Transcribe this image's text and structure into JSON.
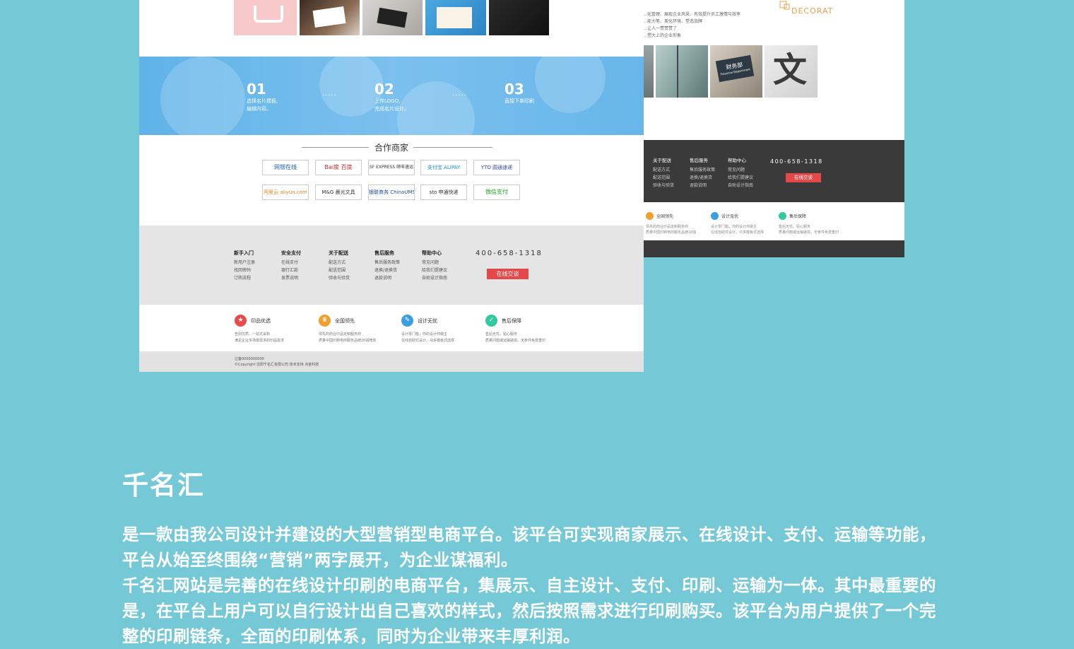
{
  "right_mockup": {
    "top_text": [
      "…化管理、展现企业风采、有效提升员工激情与效率",
      "…能力笔、美化环境、塑造品牌",
      "…让人一赞赞赞了",
      "…塑大上的企业形象"
    ],
    "deco_label": "DECORATION",
    "sign_text": "财务部",
    "sign_sub": "Financial Department",
    "footer_cols": [
      {
        "head": "关于配送",
        "items": [
          "配送方式",
          "配送范围",
          "验收与验货"
        ]
      },
      {
        "head": "售后服务",
        "items": [
          "售后服务政策",
          "退换/退换货",
          "退款说明"
        ]
      },
      {
        "head": "帮助中心",
        "items": [
          "常见问题",
          "给我们提建议",
          "自助设计指南"
        ]
      }
    ],
    "phone": "400-658-1318",
    "chat": "在线交谈",
    "features": [
      {
        "title": "全国领先",
        "desc": [
          "领先的商业印品定制服务商",
          "质量中国印刷电商服务品牌20强"
        ],
        "color": "#f0a030"
      },
      {
        "title": "设计无忧",
        "desc": [
          "设计零门槛，你的设计你做主",
          "在线自助式设计，众多模板式选择"
        ],
        "color": "#3c9ee0"
      },
      {
        "title": "售后保障",
        "desc": [
          "售后无忧，贴心服务",
          "质量问题或运输破损，无条件免费重印"
        ],
        "color": "#33c9a0"
      }
    ]
  },
  "left_mockup": {
    "steps": [
      {
        "num": "01",
        "lines": [
          "选择名片模板,",
          "编辑内容。"
        ]
      },
      {
        "num": "02",
        "lines": [
          "上传LOGO,",
          "完成名片设计。"
        ]
      },
      {
        "num": "03",
        "lines": [
          "直接下单印刷"
        ]
      }
    ],
    "dots": "·····",
    "partners_title": "合作商家",
    "partners": [
      [
        "网银在线",
        "Bai度 百度",
        "SF EXPRESS 顺丰速运",
        "支付宝 ALIPAY",
        "YTO 圆通速递"
      ],
      [
        "阿里云 aliyun.com",
        "M&G 晨光文具",
        "银联商务 ChinaUMS",
        "sto 申通快递",
        "微信支付"
      ]
    ],
    "footer_cols": [
      {
        "head": "新手入门",
        "items": [
          "新用户注册",
          "找回密码",
          "订购流程"
        ]
      },
      {
        "head": "安全支付",
        "items": [
          "在线支付",
          "银行汇款",
          "发票说明"
        ]
      },
      {
        "head": "关于配送",
        "items": [
          "配送方式",
          "配送范围",
          "验收与验货"
        ]
      },
      {
        "head": "售后服务",
        "items": [
          "售后服务政策",
          "退换/退换货",
          "退款说明"
        ]
      },
      {
        "head": "帮助中心",
        "items": [
          "常见问题",
          "给我们提建议",
          "自助设计指南"
        ]
      }
    ],
    "phone": "400-658-1318",
    "chat": "在线交谈",
    "features": [
      {
        "title": "印品优选",
        "desc": [
          "告别优质、一站式采购",
          "满足企业多场景需求的印品需求"
        ],
        "color": "#e84b4b",
        "icon": "★"
      },
      {
        "title": "全国领先",
        "desc": [
          "领先的商业印品定制服务商",
          "质量中国印刷电商服务品牌20强榜单"
        ],
        "color": "#f0a030",
        "icon": "♛"
      },
      {
        "title": "设计无忧",
        "desc": [
          "设计零门槛，你的设计你做主",
          "在线自助式设计，众多模板式选择"
        ],
        "color": "#3c9ee0",
        "icon": "✎"
      },
      {
        "title": "售后保障",
        "desc": [
          "售后无忧，贴心服务",
          "质量问题或运输破损，无条件免费重印"
        ],
        "color": "#33c9a0",
        "icon": "✓"
      }
    ],
    "copyright": [
      "辽备0000000000",
      "©Copyright 沈阳千名汇有限公司   技术支持  点金科技"
    ]
  },
  "project": {
    "title": "千名汇",
    "paragraphs": [
      "是一款由我公司设计并建设的大型营销型电商平台。该平台可实现商家展示、在线设计、支付、运输等功能，平台从始至终围绕“营销”两字展开，为企业谋福利。",
      "千名汇网站是完善的在线设计印刷的电商平台，集展示、自主设计、支付、印刷、运输为一体。其中最重要的是，在平台上用户可以自行设计出自己喜欢的样式，然后按照需求进行印刷购买。该平台为用户提供了一个完整的印刷链条，全面的印刷体系，同时为企业带来丰厚利润。"
    ]
  }
}
